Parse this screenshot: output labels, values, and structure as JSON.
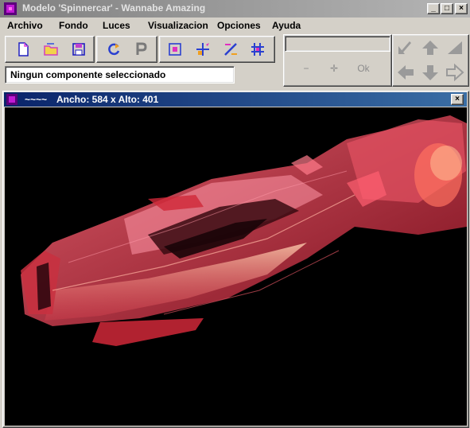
{
  "window": {
    "title": "Modelo  'Spinnercar' -  Wannabe Amazing",
    "minimize_glyph": "_",
    "maximize_glyph": "□",
    "close_glyph": "×"
  },
  "menu": [
    "Archivo",
    "Fondo",
    "Luces",
    "Visualizacion",
    "Opciones",
    "Ayuda"
  ],
  "toolbar": {
    "groups": [
      [
        "new-file-icon",
        "open-folder-icon",
        "save-icon"
      ],
      [
        "rotate-icon",
        "p-icon"
      ],
      [
        "select-box-icon",
        "move-icon",
        "scale-icon",
        "grid-icon"
      ]
    ]
  },
  "status": {
    "text": "Ningun componente seleccionado"
  },
  "value_field": {
    "value": ""
  },
  "action_buttons": {
    "minus": "−",
    "crosshair": "✛",
    "ok": "Ok"
  },
  "arrows": [
    "diag-up-left-arrow-icon",
    "up-arrow-icon",
    "diag-up-right-arrow-icon",
    "left-arrow-icon",
    "down-arrow-icon",
    "right-arrow-icon"
  ],
  "viewport": {
    "name": "~~~~",
    "dims": "Ancho: 584 x  Alto: 401",
    "close_glyph": "×",
    "background": "#000000"
  },
  "colors": {
    "accent_title": "#0a246a",
    "icon_purple": "#7a1fa0",
    "model_red": "#c8283a"
  }
}
